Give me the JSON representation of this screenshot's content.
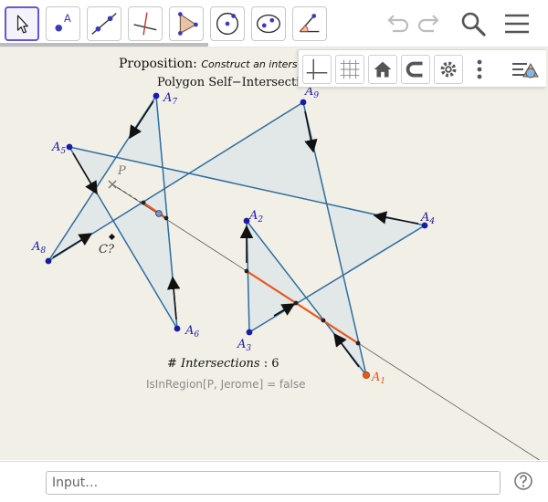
{
  "toolbar": {
    "tools": [
      {
        "name": "move-tool",
        "icon": "arrow-cursor-icon",
        "active": true
      },
      {
        "name": "point-tool",
        "icon": "point-icon",
        "label": "A"
      },
      {
        "name": "line-tool",
        "icon": "line-through-points-icon"
      },
      {
        "name": "perpendicular-line-tool",
        "icon": "perpendicular-line-icon"
      },
      {
        "name": "polygon-tool",
        "icon": "polygon-icon"
      },
      {
        "name": "circle-tool",
        "icon": "circle-center-point-icon"
      },
      {
        "name": "ellipse-tool",
        "icon": "ellipse-icon"
      },
      {
        "name": "angle-tool",
        "icon": "angle-icon"
      }
    ],
    "actions": [
      "undo-icon",
      "redo-icon",
      "search-icon",
      "menu-icon"
    ]
  },
  "style_bar": {
    "buttons": [
      "axes-icon",
      "grid-icon",
      "home-icon",
      "point-capturing-icon",
      "settings-icon",
      "more-vertical-icon",
      "algebra-view-toggle-icon"
    ]
  },
  "graphics": {
    "proposition_label": "Proposition:",
    "proposition_text": "Construct an intersect",
    "polygon_title": "Polygon Self−Intersection",
    "intersections_label": "# Intersections",
    "intersections_count": ": 6",
    "isinregion_text": "IsInRegion[P, Jerome] = false",
    "points": [
      {
        "label": "A",
        "sub": "1"
      },
      {
        "label": "A",
        "sub": "2"
      },
      {
        "label": "A",
        "sub": "3"
      },
      {
        "label": "A",
        "sub": "4"
      },
      {
        "label": "A",
        "sub": "5"
      },
      {
        "label": "A",
        "sub": "6"
      },
      {
        "label": "A",
        "sub": "7"
      },
      {
        "label": "A",
        "sub": "8"
      },
      {
        "label": "A",
        "sub": "9"
      }
    ],
    "point_p_label": "P",
    "point_c_label": "C?",
    "colors": {
      "polygon_stroke": "#2d6e9e",
      "polygon_fill": "#dfe5e6",
      "vertex": "#1a1aa8",
      "highlight": "#e8571e",
      "canvas": "#f2efe6"
    }
  },
  "input_bar": {
    "placeholder": "Input…"
  }
}
